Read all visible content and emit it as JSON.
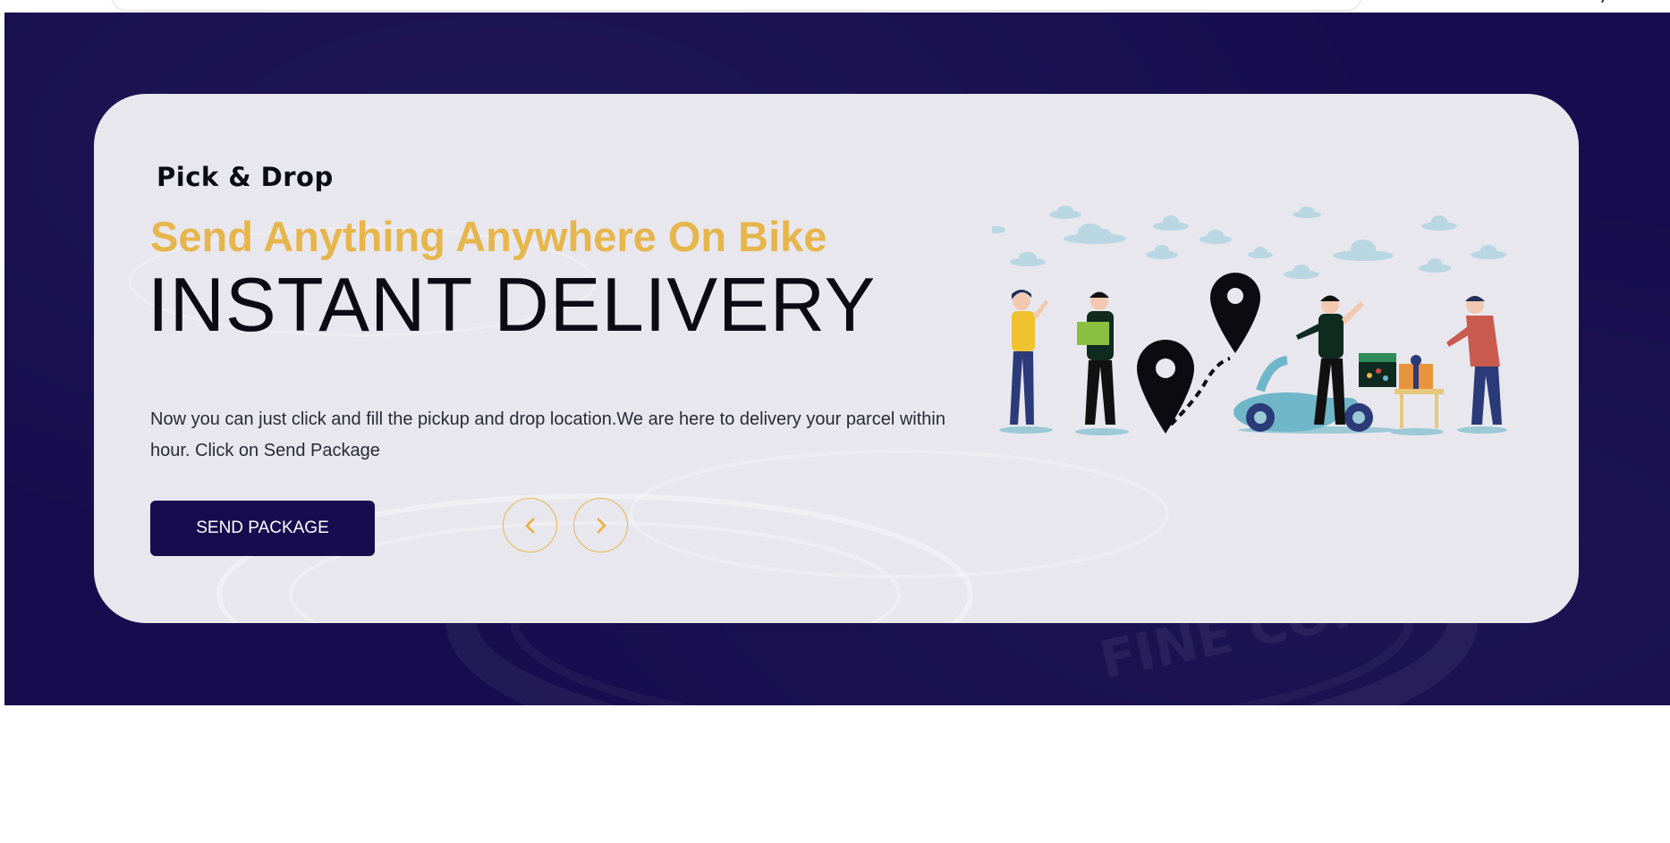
{
  "brand": {
    "name": "Pick & Drop"
  },
  "hero": {
    "tagline": "Send Anything Anywhere On Bike",
    "headline": "INSTANT DELIVERY",
    "description": "Now you can just click and fill the pickup and drop location.We are here to delivery your parcel within hour. Click on Send Package",
    "cta_label": "SEND PACKAGE",
    "prev_icon": "chevron-left-icon",
    "next_icon": "chevron-right-icon",
    "watermark_text": "FINE COPPER"
  },
  "colors": {
    "hero_background": "#170d4e",
    "card_background": "#e8e7ee",
    "accent": "#e6b64c",
    "button": "#170d4e"
  }
}
